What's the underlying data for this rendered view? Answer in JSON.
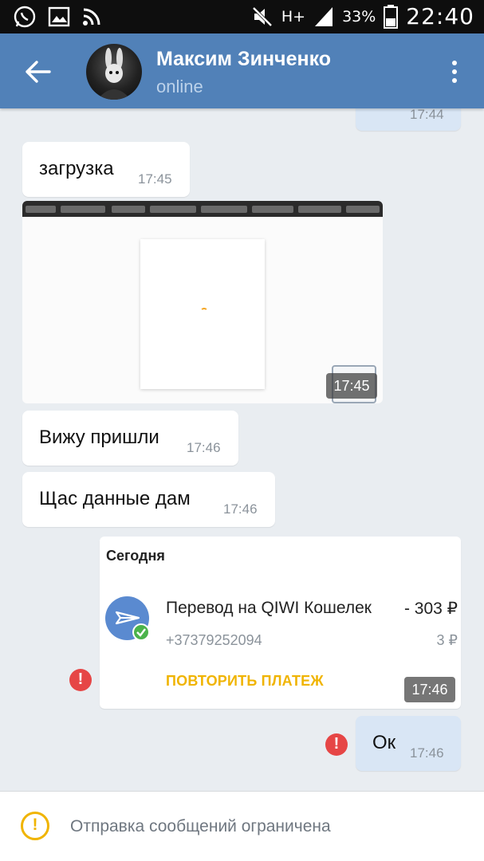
{
  "status_bar": {
    "battery": "33%",
    "network": "H+",
    "time": "22:40"
  },
  "header": {
    "contact_name": "Максим Зинченко",
    "status": "online"
  },
  "messages": [
    {
      "text": "",
      "time": "17:44"
    },
    {
      "text": "загрузка",
      "time": "17:45"
    },
    {
      "text": "",
      "time": "17:45"
    },
    {
      "text": "Вижу пришли",
      "time": "17:46"
    },
    {
      "text": "Щас данные дам",
      "time": "17:46"
    },
    {
      "text": "Ок",
      "time": "17:46"
    }
  ],
  "payment": {
    "section": "Сегодня",
    "title": "Перевод на QIWI Кошелек",
    "amount": "- 303 ₽",
    "phone": "+37379252094",
    "fee": "3 ₽",
    "repeat_label": "ПОВТОРИТЬ ПЛАТЕЖ",
    "time": "17:46"
  },
  "bottom": {
    "notice": "Отправка сообщений ограничена"
  },
  "colors": {
    "header": "#5181b8",
    "outgoing_bubble": "#d9e6f5",
    "error": "#e64646",
    "warning": "#f0b400"
  }
}
